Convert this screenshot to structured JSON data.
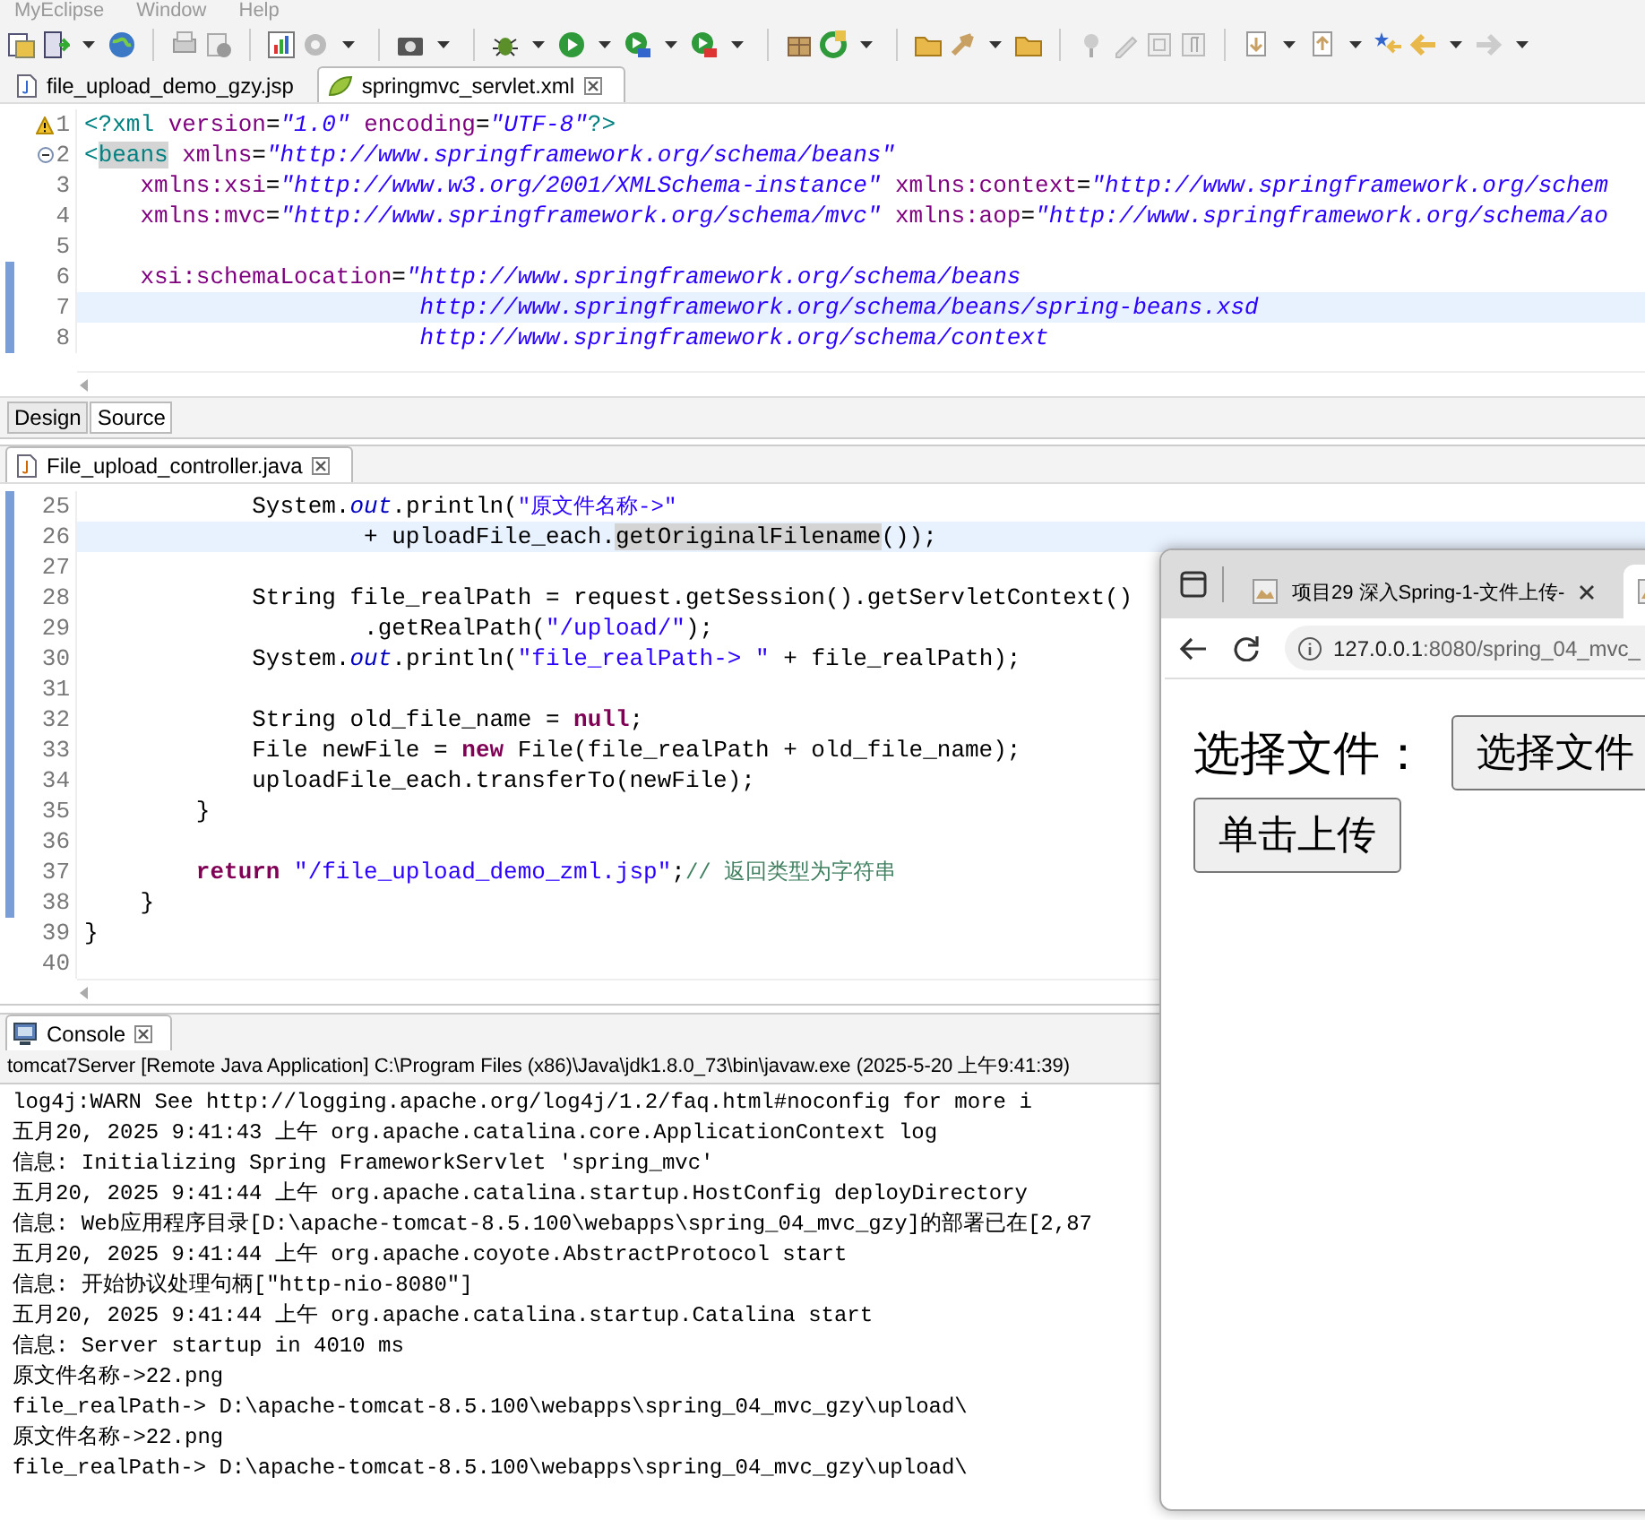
{
  "menu_bar": [
    "MyEclipse",
    "Window",
    "Help"
  ],
  "xml_editor": {
    "tabs": [
      {
        "label": "file_upload_demo_gzy.jsp",
        "selected": false,
        "kind": "jsp"
      },
      {
        "label": "springmvc_servlet.xml",
        "selected": true,
        "kind": "xml"
      }
    ],
    "lines": [
      {
        "number": "1",
        "kind": "warning",
        "current": false,
        "changed": false,
        "tokens": [
          {
            "t": "<?xml",
            "kind": "tag"
          },
          {
            "t": " version",
            "kind": "attr"
          },
          {
            "t": "=",
            "kind": "plain"
          },
          {
            "t": "\"1.0\"",
            "kind": "value"
          },
          {
            "t": " encoding",
            "kind": "attr"
          },
          {
            "t": "=",
            "kind": "plain"
          },
          {
            "t": "\"UTF-8\"",
            "kind": "value"
          },
          {
            "t": "?>",
            "kind": "tag"
          }
        ]
      },
      {
        "number": "2",
        "kind": "fold",
        "current": false,
        "changed": false,
        "tokens": [
          {
            "t": "<",
            "kind": "tag"
          },
          {
            "t": "beans",
            "kind": "tagmark"
          },
          {
            "t": " xmlns",
            "kind": "attr"
          },
          {
            "t": "=",
            "kind": "plain"
          },
          {
            "t": "\"http://www.springframework.org/schema/beans\"",
            "kind": "value"
          }
        ]
      },
      {
        "number": "3",
        "kind": "plain",
        "current": false,
        "changed": false,
        "tokens": [
          {
            "t": "    xmlns:xsi",
            "kind": "attr"
          },
          {
            "t": "=",
            "kind": "plain"
          },
          {
            "t": "\"http://www.w3.org/2001/XMLSchema-instance\"",
            "kind": "value"
          },
          {
            "t": " xmlns:context",
            "kind": "attr"
          },
          {
            "t": "=",
            "kind": "plain"
          },
          {
            "t": "\"http://www.springframework.org/schem",
            "kind": "value"
          }
        ]
      },
      {
        "number": "4",
        "kind": "plain",
        "current": false,
        "changed": false,
        "tokens": [
          {
            "t": "    xmlns:mvc",
            "kind": "attr"
          },
          {
            "t": "=",
            "kind": "plain"
          },
          {
            "t": "\"http://www.springframework.org/schema/mvc\"",
            "kind": "value"
          },
          {
            "t": " xmlns:aop",
            "kind": "attr"
          },
          {
            "t": "=",
            "kind": "plain"
          },
          {
            "t": "\"http://www.springframework.org/schema/ao",
            "kind": "value"
          }
        ]
      },
      {
        "number": "5",
        "kind": "plain",
        "current": false,
        "changed": false
      },
      {
        "number": "6",
        "kind": "plain",
        "current": false,
        "changed": true,
        "tokens": [
          {
            "t": "    xsi:schemaLocation",
            "kind": "attr"
          },
          {
            "t": "=",
            "kind": "plain"
          },
          {
            "t": "\"http://www.springframework.org/schema/beans",
            "kind": "value"
          }
        ]
      },
      {
        "number": "7",
        "kind": "plain",
        "current": true,
        "changed": true,
        "tokens": [
          {
            "t": "                        http://www.springframework.org/schema/beans/spring-beans.xsd",
            "kind": "value"
          }
        ]
      },
      {
        "number": "8",
        "kind": "plain",
        "current": false,
        "changed": true,
        "tokens": [
          {
            "t": "                        http://www.springframework.org/schema/context",
            "kind": "value"
          }
        ]
      }
    ],
    "view_tabs": [
      {
        "label": "Design",
        "selected": false
      },
      {
        "label": "Source",
        "selected": true
      }
    ]
  },
  "java_editor": {
    "tab": {
      "label": "File_upload_controller.java"
    },
    "lines": [
      {
        "number": "25",
        "current": false,
        "changed": true,
        "tokens": [
          {
            "t": "            System.",
            "kind": "plain"
          },
          {
            "t": "out",
            "kind": "field"
          },
          {
            "t": ".println(",
            "kind": "plain"
          },
          {
            "t": "\"原文件名称->\"",
            "kind": "str"
          }
        ]
      },
      {
        "number": "26",
        "current": true,
        "changed": true,
        "tokens": [
          {
            "t": "                    + uploadFile_each.",
            "kind": "plain"
          },
          {
            "t": "getOriginalFilename",
            "kind": "mark"
          },
          {
            "t": "());",
            "kind": "plain"
          }
        ]
      },
      {
        "number": "27",
        "current": false,
        "changed": true
      },
      {
        "number": "28",
        "current": false,
        "changed": true,
        "tokens": [
          {
            "t": "            String file_realPath = request.getSession().getServletContext()",
            "kind": "plain"
          }
        ]
      },
      {
        "number": "29",
        "current": false,
        "changed": true,
        "tokens": [
          {
            "t": "                    .getRealPath(",
            "kind": "plain"
          },
          {
            "t": "\"/upload/\"",
            "kind": "str"
          },
          {
            "t": ");",
            "kind": "plain"
          }
        ]
      },
      {
        "number": "30",
        "current": false,
        "changed": true,
        "tokens": [
          {
            "t": "            System.",
            "kind": "plain"
          },
          {
            "t": "out",
            "kind": "field"
          },
          {
            "t": ".println(",
            "kind": "plain"
          },
          {
            "t": "\"file_realPath-> \"",
            "kind": "str"
          },
          {
            "t": " + file_realPath);",
            "kind": "plain"
          }
        ]
      },
      {
        "number": "31",
        "current": false,
        "changed": true
      },
      {
        "number": "32",
        "current": false,
        "changed": true,
        "tokens": [
          {
            "t": "            String old_file_name = ",
            "kind": "plain"
          },
          {
            "t": "null",
            "kind": "kw"
          },
          {
            "t": ";",
            "kind": "plain"
          }
        ]
      },
      {
        "number": "33",
        "current": false,
        "changed": true,
        "tokens": [
          {
            "t": "            File newFile = ",
            "kind": "plain"
          },
          {
            "t": "new",
            "kind": "kw"
          },
          {
            "t": " File(file_realPath + old_file_name);",
            "kind": "plain"
          }
        ]
      },
      {
        "number": "34",
        "current": false,
        "changed": true,
        "tokens": [
          {
            "t": "            uploadFile_each.transferTo(newFile);",
            "kind": "plain"
          }
        ]
      },
      {
        "number": "35",
        "current": false,
        "changed": true,
        "tokens": [
          {
            "t": "        }",
            "kind": "plain"
          }
        ]
      },
      {
        "number": "36",
        "current": false,
        "changed": true
      },
      {
        "number": "37",
        "current": false,
        "changed": true,
        "tokens": [
          {
            "t": "        return",
            "kind": "kw"
          },
          {
            "t": " \"/file_upload_demo_zml.jsp\"",
            "kind": "str"
          },
          {
            "t": ";",
            "kind": "plain"
          },
          {
            "t": "// 返回类型为字符串",
            "kind": "comment"
          }
        ]
      },
      {
        "number": "38",
        "current": false,
        "changed": true,
        "tokens": [
          {
            "t": "    }",
            "kind": "plain"
          }
        ]
      },
      {
        "number": "39",
        "current": false,
        "changed": false,
        "tokens": [
          {
            "t": "}",
            "kind": "plain"
          }
        ]
      },
      {
        "number": "40",
        "current": false,
        "changed": false
      }
    ]
  },
  "console": {
    "tab": {
      "label": "Console"
    },
    "header": "tomcat7Server [Remote Java Application] C:\\Program Files (x86)\\Java\\jdk1.8.0_73\\bin\\javaw.exe (2025-5-20 上午9:41:39)",
    "lines": [
      "log4j:WARN See http://logging.apache.org/log4j/1.2/faq.html#noconfig for more i",
      "五月20, 2025 9:41:43 上午 org.apache.catalina.core.ApplicationContext log",
      "信息: Initializing Spring FrameworkServlet 'spring_mvc'",
      "五月20, 2025 9:41:44 上午 org.apache.catalina.startup.HostConfig deployDirectory",
      "信息: Web应用程序目录[D:\\apache-tomcat-8.5.100\\webapps\\spring_04_mvc_gzy]的部署已在[2,87",
      "五月20, 2025 9:41:44 上午 org.apache.coyote.AbstractProtocol start",
      "信息: 开始协议处理句柄[\"http-nio-8080\"]",
      "五月20, 2025 9:41:44 上午 org.apache.catalina.startup.Catalina start",
      "信息: Server startup in 4010 ms",
      "原文件名称->22.png",
      "file_realPath-> D:\\apache-tomcat-8.5.100\\webapps\\spring_04_mvc_gzy\\upload\\",
      "原文件名称->22.png",
      "file_realPath-> D:\\apache-tomcat-8.5.100\\webapps\\spring_04_mvc_gzy\\upload\\"
    ]
  },
  "browser": {
    "tabs": [
      {
        "title": "项目29 深入Spring-1-文件上传-",
        "selected": false
      },
      {
        "selected": true
      }
    ],
    "url_host": "127.0.0.1",
    "url_rest": ":8080/spring_04_mvc_",
    "page": {
      "label": "选择文件：",
      "file_button": "选择文件",
      "submit_button": "单击上传"
    }
  }
}
